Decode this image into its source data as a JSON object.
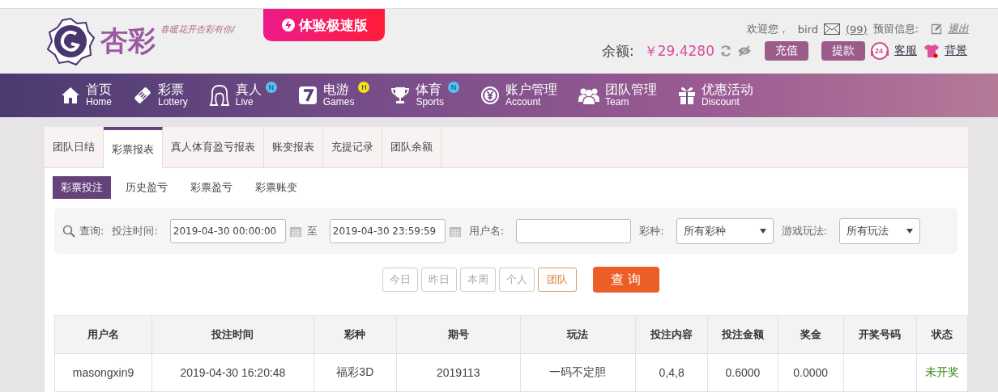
{
  "logo": {
    "name": "杏彩",
    "slogan": "春暖花开杏彩有你/"
  },
  "promo": {
    "label": "体验极速版"
  },
  "user_bar": {
    "welcome": "欢迎您，",
    "username": "bird",
    "messages": "(99)",
    "reserved_label": "预留信息:",
    "logout": "退出"
  },
  "balance": {
    "label": "余额:",
    "amount": "￥29.4280",
    "deposit": "充值",
    "withdraw": "提款",
    "service_badge": "24",
    "service": "客服",
    "background": "背景"
  },
  "nav": [
    {
      "kind": "home",
      "label": "首页",
      "sub": "Home"
    },
    {
      "kind": "ticket",
      "label": "彩票",
      "sub": "Lottery"
    },
    {
      "kind": "live",
      "label": "真人",
      "sub": "Live",
      "badge": {
        "text": "N",
        "color": "#4fc3f7"
      }
    },
    {
      "kind": "seven",
      "label": "电游",
      "sub": "Games",
      "badge": {
        "text": "H",
        "color": "#f5e11b"
      }
    },
    {
      "kind": "trophy",
      "label": "体育",
      "sub": "Sports",
      "badge": {
        "text": "N",
        "color": "#4fc3f7"
      }
    },
    {
      "kind": "yen",
      "label": "账户管理",
      "sub": "Account"
    },
    {
      "kind": "team",
      "label": "团队管理",
      "sub": "Team"
    },
    {
      "kind": "gift",
      "label": "优惠活动",
      "sub": "Discount"
    }
  ],
  "tabs": [
    {
      "label": "团队日结",
      "selected": false
    },
    {
      "label": "彩票报表",
      "selected": true
    },
    {
      "label": "真人体育盈亏报表",
      "selected": false
    },
    {
      "label": "账变报表",
      "selected": false
    },
    {
      "label": "充提记录",
      "selected": false
    },
    {
      "label": "团队余额",
      "selected": false
    }
  ],
  "subtabs": [
    {
      "label": "彩票投注",
      "selected": true
    },
    {
      "label": "历史盈亏",
      "selected": false
    },
    {
      "label": "彩票盈亏",
      "selected": false
    },
    {
      "label": "彩票账变",
      "selected": false
    }
  ],
  "filter": {
    "query_label": "查询:",
    "time_label": "投注时间:",
    "start": "2019-04-30 00:00:00",
    "to": "至",
    "end": "2019-04-30 23:59:59",
    "user_label": "用户名:",
    "lottery_label": "彩种:",
    "lottery": "所有彩种",
    "play_label": "游戏玩法:",
    "play": "所有玩法"
  },
  "quick_ranges": [
    {
      "label": "今日",
      "selected": false
    },
    {
      "label": "昨日",
      "selected": false
    },
    {
      "label": "本周",
      "selected": false
    },
    {
      "label": "个人",
      "selected": false
    },
    {
      "label": "团队",
      "selected": true
    }
  ],
  "search_button": "查 询",
  "table": {
    "columns": [
      "用户名",
      "投注时间",
      "彩种",
      "期号",
      "玩法",
      "投注内容",
      "投注金额",
      "奖金",
      "开奖号码",
      "状态"
    ],
    "rows": [
      {
        "cells": [
          "masongxin9",
          "2019-04-30 16:20:48",
          "福彩3D",
          "2019113",
          "一码不定胆",
          "0,4,8",
          "0.6000",
          "0.0000",
          "",
          "未开奖"
        ],
        "color": "#3a8a1a"
      }
    ]
  }
}
